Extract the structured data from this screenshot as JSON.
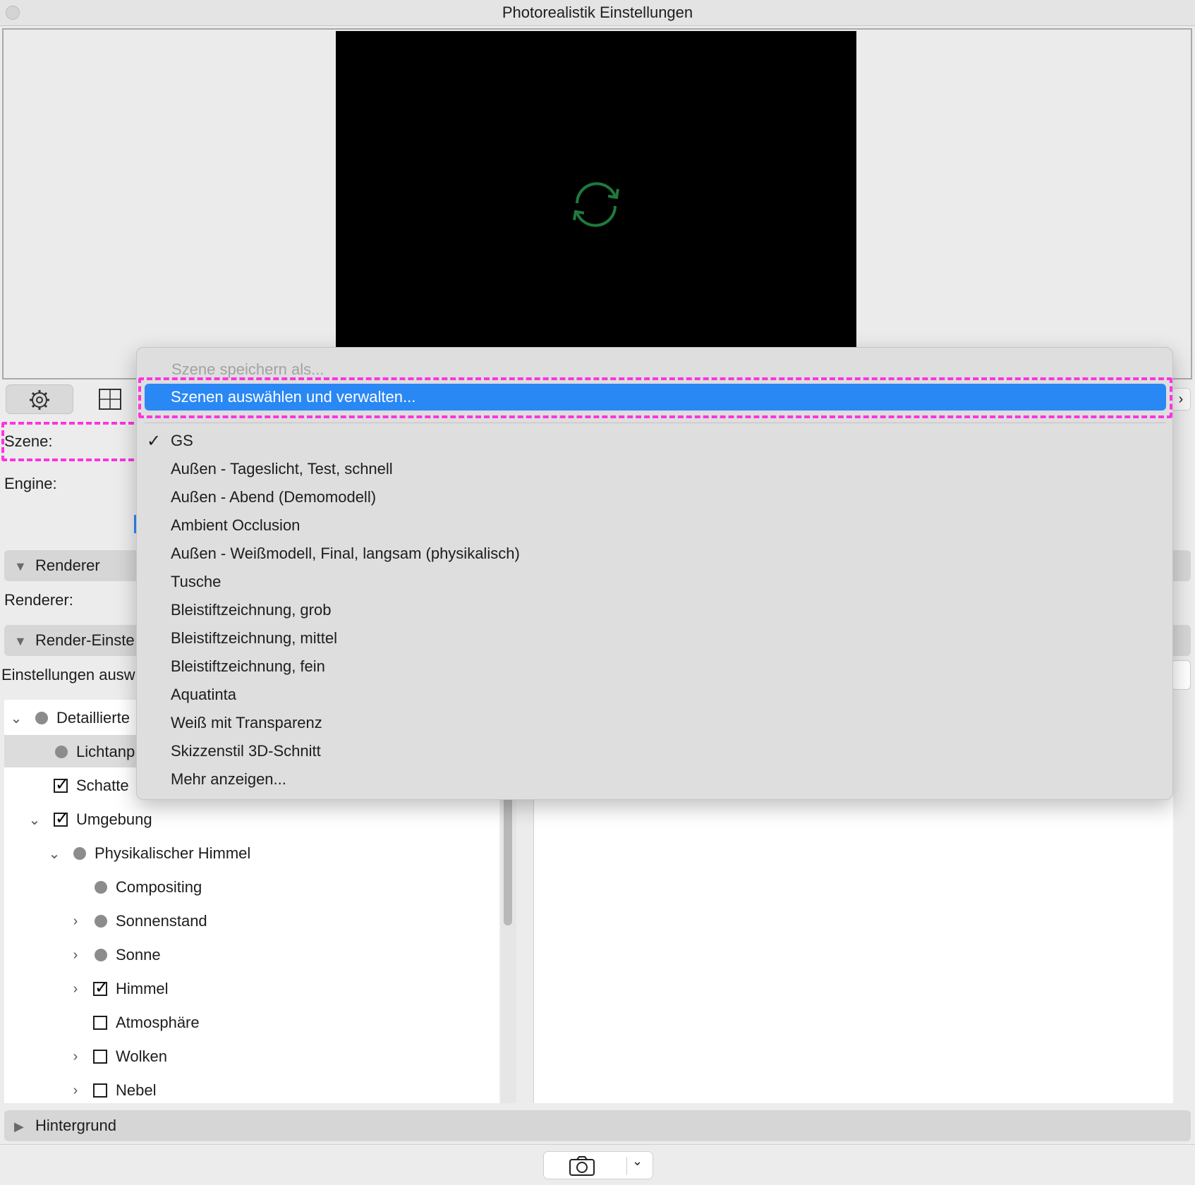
{
  "window": {
    "title": "Photorealistik Einstellungen"
  },
  "labels": {
    "scene": "Szene:",
    "engine": "Engine:",
    "renderer": "Renderer:",
    "settings_select": "Einstellungen ausw"
  },
  "sections": {
    "renderer": "Renderer",
    "render_settings": "Render-Einste",
    "background": "Hintergrund"
  },
  "dropdown": {
    "save_as": "Szene speichern als...",
    "manage": "Szenen auswählen und verwalten...",
    "items": [
      "GS",
      "Außen - Tageslicht, Test, schnell",
      "Außen - Abend (Demomodell)",
      "Ambient Occlusion",
      "Außen - Weißmodell, Final, langsam (physikalisch)",
      "Tusche",
      "Bleistiftzeichnung, grob",
      "Bleistiftzeichnung, mittel",
      "Bleistiftzeichnung, fein",
      "Aquatinta",
      "Weiß mit Transparenz",
      "Skizzenstil 3D-Schnitt",
      "Mehr anzeigen..."
    ],
    "checked": "GS"
  },
  "tree": {
    "detailed": "Detaillierte",
    "light": "Lichtanp",
    "shadow": "Schatte",
    "environment": "Umgebung",
    "physical_sky": "Physikalischer Himmel",
    "compositing": "Compositing",
    "sun_position": "Sonnenstand",
    "sun": "Sonne",
    "sky": "Himmel",
    "atmosphere": "Atmosphäre",
    "clouds": "Wolken",
    "fog": "Nebel"
  },
  "colors": {
    "highlight": "#2a88f5",
    "annotation": "#ff33e0",
    "refresh_icon": "#1e7a3c"
  },
  "icons": {
    "settings": "gear-icon",
    "frame": "frame-icon",
    "preview": "refresh-icon",
    "camera": "camera-icon"
  }
}
